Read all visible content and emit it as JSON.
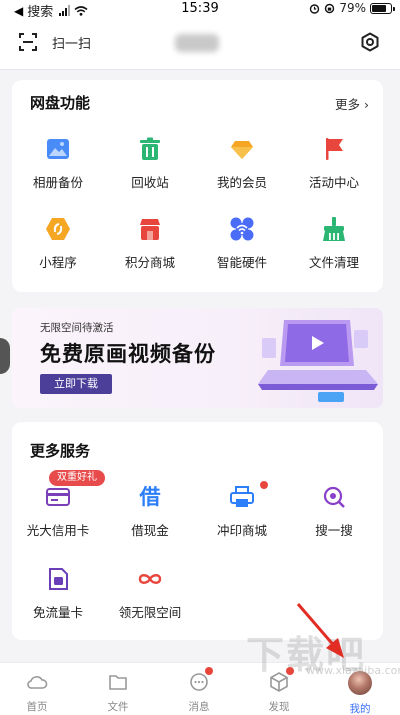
{
  "status_bar": {
    "back_app": "搜索",
    "time": "15:39",
    "battery": "79%",
    "battery_level": 0.79
  },
  "header": {
    "scan_label": "扫一扫",
    "icons": [
      "scan-icon",
      "settings-icon"
    ]
  },
  "netdisk": {
    "title": "网盘功能",
    "more": "更多 ›",
    "items": [
      {
        "label": "相册备份",
        "icon": "album-icon",
        "color": "#4a8cf7"
      },
      {
        "label": "回收站",
        "icon": "trash-icon",
        "color": "#2bb673"
      },
      {
        "label": "我的会员",
        "icon": "diamond-icon",
        "color": "#f5a623"
      },
      {
        "label": "活动中心",
        "icon": "flag-icon",
        "color": "#e8463c"
      },
      {
        "label": "小程序",
        "icon": "hexagon-icon",
        "color": "#f5a623"
      },
      {
        "label": "积分商城",
        "icon": "shop-icon",
        "color": "#e8463c"
      },
      {
        "label": "智能硬件",
        "icon": "wifi-device-icon",
        "color": "#4a6cf7"
      },
      {
        "label": "文件清理",
        "icon": "broom-icon",
        "color": "#2bb673"
      }
    ]
  },
  "banner": {
    "subtitle": "无限空间待激活",
    "title": "免费原画视频备份",
    "button": "立即下载"
  },
  "services": {
    "title": "更多服务",
    "promo_badge": "双重好礼",
    "items": [
      {
        "label": "光大信用卡",
        "icon": "credit-card-icon",
        "color": "#7b3fb8"
      },
      {
        "label": "借现金",
        "icon": "borrow-icon",
        "glyph": "借",
        "color": "#2d7ff9"
      },
      {
        "label": "冲印商城",
        "icon": "printer-icon",
        "color": "#2d7ff9"
      },
      {
        "label": "搜一搜",
        "icon": "search-icon",
        "color": "#8a3fc8"
      },
      {
        "label": "免流量卡",
        "icon": "sim-card-icon",
        "color": "#6b3fb8"
      },
      {
        "label": "领无限空间",
        "icon": "infinity-icon",
        "color": "#e8463c"
      }
    ]
  },
  "tabbar": {
    "tabs": [
      {
        "label": "首页",
        "icon": "cloud-icon"
      },
      {
        "label": "文件",
        "icon": "folder-icon"
      },
      {
        "label": "消息",
        "icon": "message-icon"
      },
      {
        "label": "发现",
        "icon": "cube-icon"
      },
      {
        "label": "我的",
        "icon": "avatar"
      }
    ],
    "active": "我的",
    "accent": "#3a6ff7"
  },
  "watermark": {
    "text": "下载吧",
    "url": "www.xiazaiba.com"
  }
}
